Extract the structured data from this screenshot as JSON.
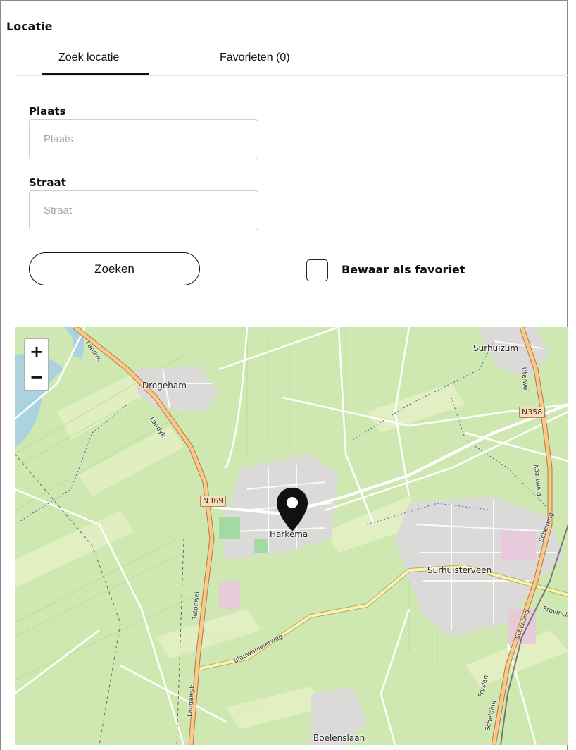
{
  "panel": {
    "title": "Locatie"
  },
  "tabs": [
    {
      "label": "Zoek locatie",
      "active": true
    },
    {
      "label": "Favorieten (0)",
      "active": false
    }
  ],
  "form": {
    "plaats": {
      "label": "Plaats",
      "placeholder": "Plaats",
      "value": ""
    },
    "straat": {
      "label": "Straat",
      "placeholder": "Straat",
      "value": ""
    },
    "search_button": "Zoeken",
    "favorite_checkbox": {
      "label": "Bewaar als favoriet",
      "checked": false
    }
  },
  "map": {
    "zoom_in": "+",
    "zoom_out": "−",
    "places": [
      "Drogeham",
      "Harkema",
      "Surhuizum",
      "Surhuisterveen",
      "Boelenslaan"
    ],
    "road_shields": [
      "N369",
      "N358"
    ],
    "streets": [
      "Landyk",
      "Landyk",
      "Betonwei",
      "Langewyk",
      "Blauwhuisterweg",
      "Koartwâld",
      "Uterwei",
      "Scheiding",
      "Scheiding",
      "Scheiding",
      "Provincia",
      "Fryslân"
    ],
    "marker_icon": "map-pin-icon",
    "colors": {
      "land": "#cfe8b2",
      "water": "#aad3df",
      "town": "#e0dfdf",
      "major_road": "#f8c98b",
      "secondary_road": "#f7f3b0"
    }
  }
}
